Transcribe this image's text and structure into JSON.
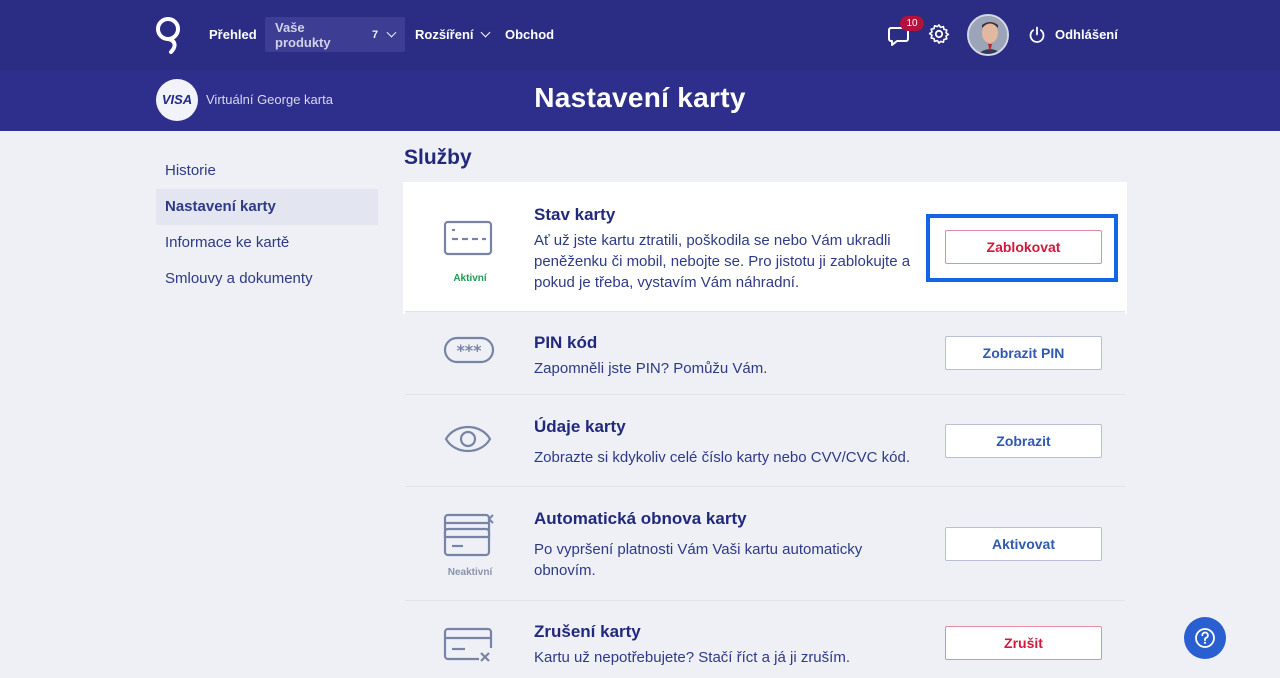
{
  "topbar": {
    "nav": [
      {
        "label": "Přehled"
      },
      {
        "label": "Vaše produkty",
        "count": "7"
      },
      {
        "label": "Rozšíření"
      },
      {
        "label": "Obchod"
      }
    ],
    "messages_badge": "10",
    "logout_label": "Odhlášení"
  },
  "subbar": {
    "visa_label": "VISA",
    "card_name": "Virtuální George karta",
    "title": "Nastavení karty"
  },
  "sidenav": {
    "items": [
      {
        "label": "Historie"
      },
      {
        "label": "Nastavení karty"
      },
      {
        "label": "Informace ke kartě"
      },
      {
        "label": "Smlouvy a dokumenty"
      }
    ]
  },
  "services": {
    "title": "Služby",
    "rows": [
      {
        "title": "Stav karty",
        "desc": "Ať už jste kartu ztratili, poškodila se nebo Vám ukradli peněženku či mobil, nebojte se. Pro jistotu ji zablokujte a pokud je třeba, vystavím Vám náhradní.",
        "status": "Aktivní",
        "button": "Zablokovat",
        "icon": "card-status-icon"
      },
      {
        "title": "PIN kód",
        "desc": "Zapomněli jste PIN? Pomůžu Vám.",
        "button": "Zobrazit PIN",
        "icon": "pin-icon"
      },
      {
        "title": "Údaje karty",
        "desc": "Zobrazte si kdykoliv celé číslo karty nebo CVV/CVC kód.",
        "button": "Zobrazit",
        "icon": "eye-icon"
      },
      {
        "title": "Automatická obnova karty",
        "desc": "Po vypršení platnosti Vám Vaši kartu automaticky obnovím.",
        "status": "Neaktivní",
        "button": "Aktivovat",
        "icon": "card-renew-icon"
      },
      {
        "title": "Zrušení karty",
        "desc": "Kartu už nepotřebujete? Stačí říct a já ji zruším.",
        "button": "Zrušit",
        "icon": "card-cancel-icon"
      }
    ]
  },
  "colors": {
    "topbar": "#2b2c84",
    "accent": "#3059b0",
    "danger": "#d1193e",
    "active_status": "#1f9b4f",
    "inactive_status": "#8a93ad",
    "focus": "#1464e6"
  }
}
